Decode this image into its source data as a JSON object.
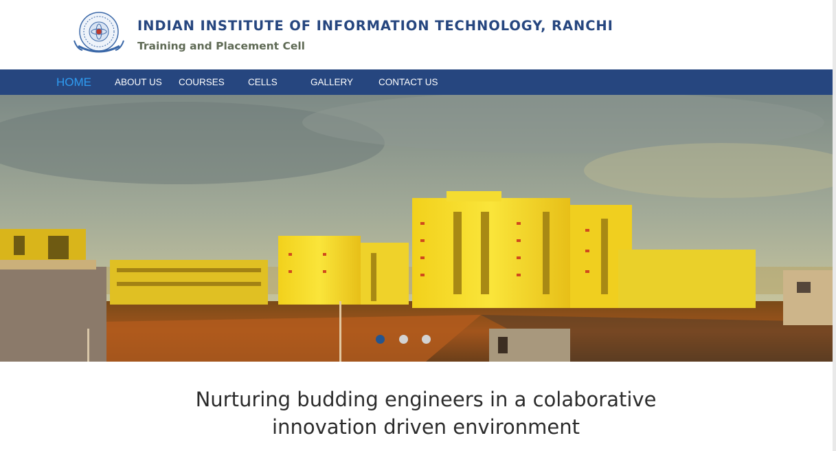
{
  "header": {
    "institute_name": "INDIAN INSTITUTE OF INFORMATION TECHNOLOGY, RANCHI",
    "subtitle": "Training and Placement Cell",
    "logo_icon": "iiit-ranchi-seal-logo"
  },
  "nav": {
    "items": [
      {
        "label": "HOME",
        "active": true
      },
      {
        "label": "ABOUT US"
      },
      {
        "label": "COURSES"
      },
      {
        "label": "CELLS"
      },
      {
        "label": "GALLERY"
      },
      {
        "label": "CONTACT US"
      }
    ]
  },
  "carousel": {
    "slide_count": 3,
    "active_index": 0,
    "image": "campus-buildings-sunset-photo"
  },
  "tagline": {
    "line1": "Nurturing budding engineers in a colaborative",
    "line2": "innovation driven environment"
  },
  "colors": {
    "brand_blue": "#26467f",
    "nav_active": "#2f9df3",
    "subtitle_green": "#5f6a55",
    "dot_active": "#24558f",
    "dot_inactive": "#d3d3d3"
  }
}
